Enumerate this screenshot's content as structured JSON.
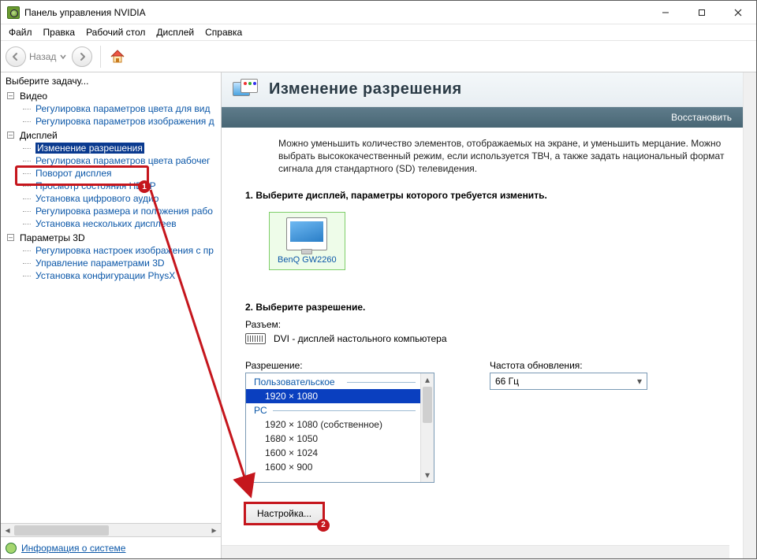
{
  "window": {
    "title": "Панель управления NVIDIA"
  },
  "menu": {
    "file": "Файл",
    "edit": "Правка",
    "desktop": "Рабочий стол",
    "display": "Дисплей",
    "help": "Справка"
  },
  "toolbar": {
    "back": "Назад"
  },
  "nav": {
    "select_task": "Выберите задачу...",
    "video": {
      "label": "Видео",
      "items": [
        "Регулировка параметров цвета для вид",
        "Регулировка параметров изображения д"
      ]
    },
    "display": {
      "label": "Дисплей",
      "items": [
        "Изменение разрешения",
        "Регулировка параметров цвета рабочег",
        "Поворот дисплея",
        "Просмотр состояния HDCP",
        "Установка цифрового аудио",
        "Регулировка размера и положения рабо",
        "Установка нескольких дисплеев"
      ],
      "selected_index": 0
    },
    "params3d": {
      "label": "Параметры 3D",
      "items": [
        "Регулировка настроек изображения с пр",
        "Управление параметрами 3D",
        "Установка конфигурации PhysX"
      ]
    },
    "system_info": "Информация о системе"
  },
  "page": {
    "title": "Изменение разрешения",
    "restore": "Восстановить",
    "description": "Можно уменьшить количество элементов, отображаемых на экране, и уменьшить мерцание. Можно выбрать высококачественный режим, если используется ТВЧ, а также задать национальный формат сигнала для стандартного (SD) телевидения.",
    "step1": "1. Выберите дисплей, параметры которого требуется изменить.",
    "display_name": "BenQ GW2260",
    "step2": "2. Выберите разрешение.",
    "connector_label": "Разъем:",
    "connector_value": "DVI - дисплей настольного компьютера",
    "resolution_label": "Разрешение:",
    "refresh_label": "Частота обновления:",
    "refresh_value": "66 Гц",
    "listbox": {
      "group_custom": "Пользовательское",
      "custom_items": [
        "1920 × 1080"
      ],
      "selected": "1920 × 1080",
      "group_pc": "PC",
      "pc_items": [
        "1920 × 1080 (собственное)",
        "1680 × 1050",
        "1600 × 1024",
        "1600 × 900"
      ]
    },
    "customize_btn": "Настройка..."
  },
  "callouts": {
    "one": "1",
    "two": "2"
  }
}
